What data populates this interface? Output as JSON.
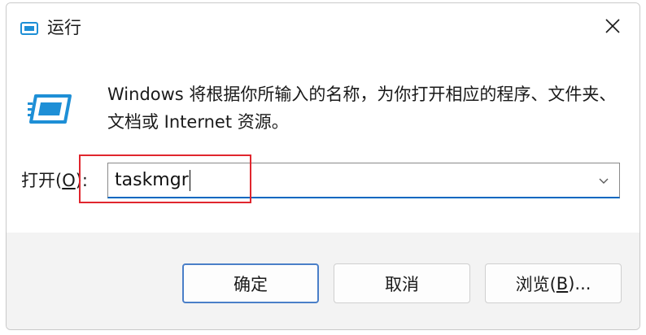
{
  "window": {
    "title": "运行",
    "icon": "run-dialog-icon",
    "close_icon": "close-icon"
  },
  "content": {
    "description": "Windows 将根据你所输入的名称，为你打开相应的程序、文件夹、文档或 Internet 资源。",
    "open_label_prefix": "打开(",
    "open_label_accel": "O",
    "open_label_suffix": "):",
    "input_value": "taskmgr",
    "dropdown_icon": "chevron-down-icon"
  },
  "buttons": {
    "ok": "确定",
    "cancel": "取消",
    "browse_prefix": "浏览(",
    "browse_accel": "B",
    "browse_suffix": ")..."
  },
  "colors": {
    "highlight": "#e0262e",
    "accent": "#0067c0",
    "icon_blue": "#1e8fd6"
  }
}
